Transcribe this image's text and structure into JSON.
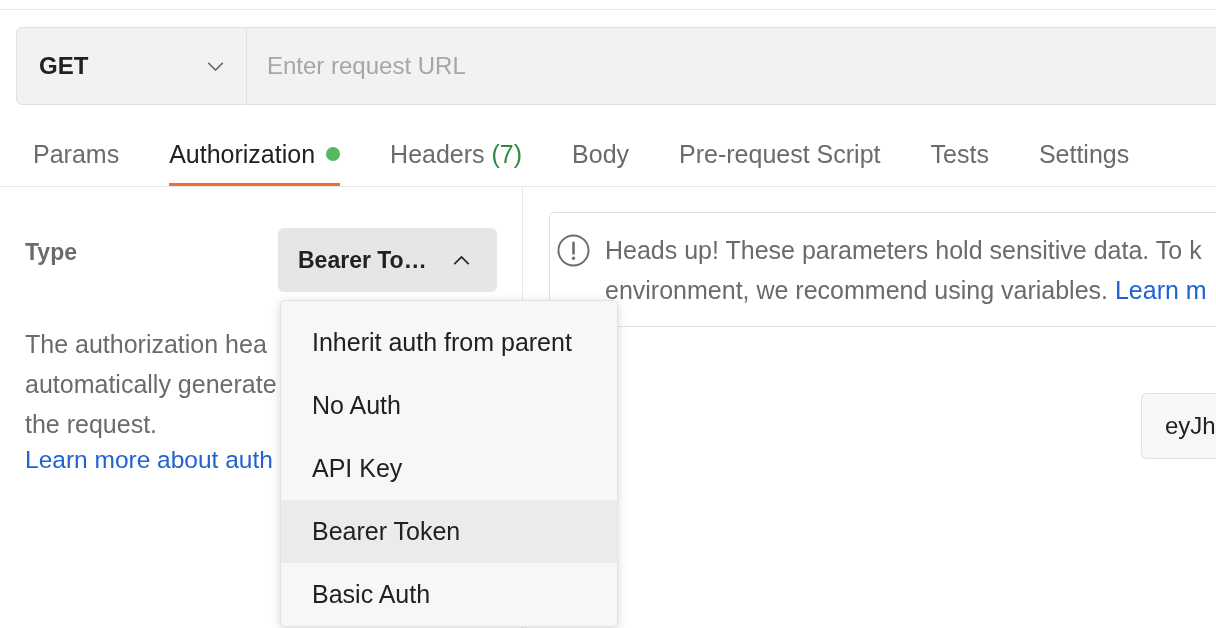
{
  "method_dropdown": {
    "value": "GET",
    "expanded": false
  },
  "url_field": {
    "placeholder": "Enter request URL"
  },
  "tabs": [
    {
      "label": "Params",
      "selected": false,
      "indicator": false
    },
    {
      "label": "Authorization",
      "selected": true,
      "indicator": true
    },
    {
      "label": "Headers",
      "count": "(7)",
      "selected": false,
      "indicator": false
    },
    {
      "label": "Body",
      "selected": false,
      "indicator": false
    },
    {
      "label": "Pre-request Script",
      "selected": false,
      "indicator": false
    },
    {
      "label": "Tests",
      "selected": false,
      "indicator": false
    },
    {
      "label": "Settings",
      "selected": false,
      "indicator": false
    }
  ],
  "auth": {
    "type_label": "Type",
    "type_dropdown": {
      "value": "Bearer To…",
      "expanded": true
    },
    "description_lines": [
      "The authorization hea",
      "automatically generate",
      "the request."
    ],
    "learn_more_link": "Learn more about auth",
    "menu_items": [
      {
        "label": "Inherit auth from parent",
        "selected": false
      },
      {
        "label": "No Auth",
        "selected": false
      },
      {
        "label": "API Key",
        "selected": false
      },
      {
        "label": "Bearer Token",
        "selected": true
      },
      {
        "label": "Basic Auth",
        "selected": false
      }
    ]
  },
  "notice": {
    "lines": [
      "Heads up! These parameters hold sensitive data. To k",
      "environment, we recommend using variables."
    ],
    "link": "Learn m"
  },
  "token_field": {
    "value": "eyJh"
  }
}
